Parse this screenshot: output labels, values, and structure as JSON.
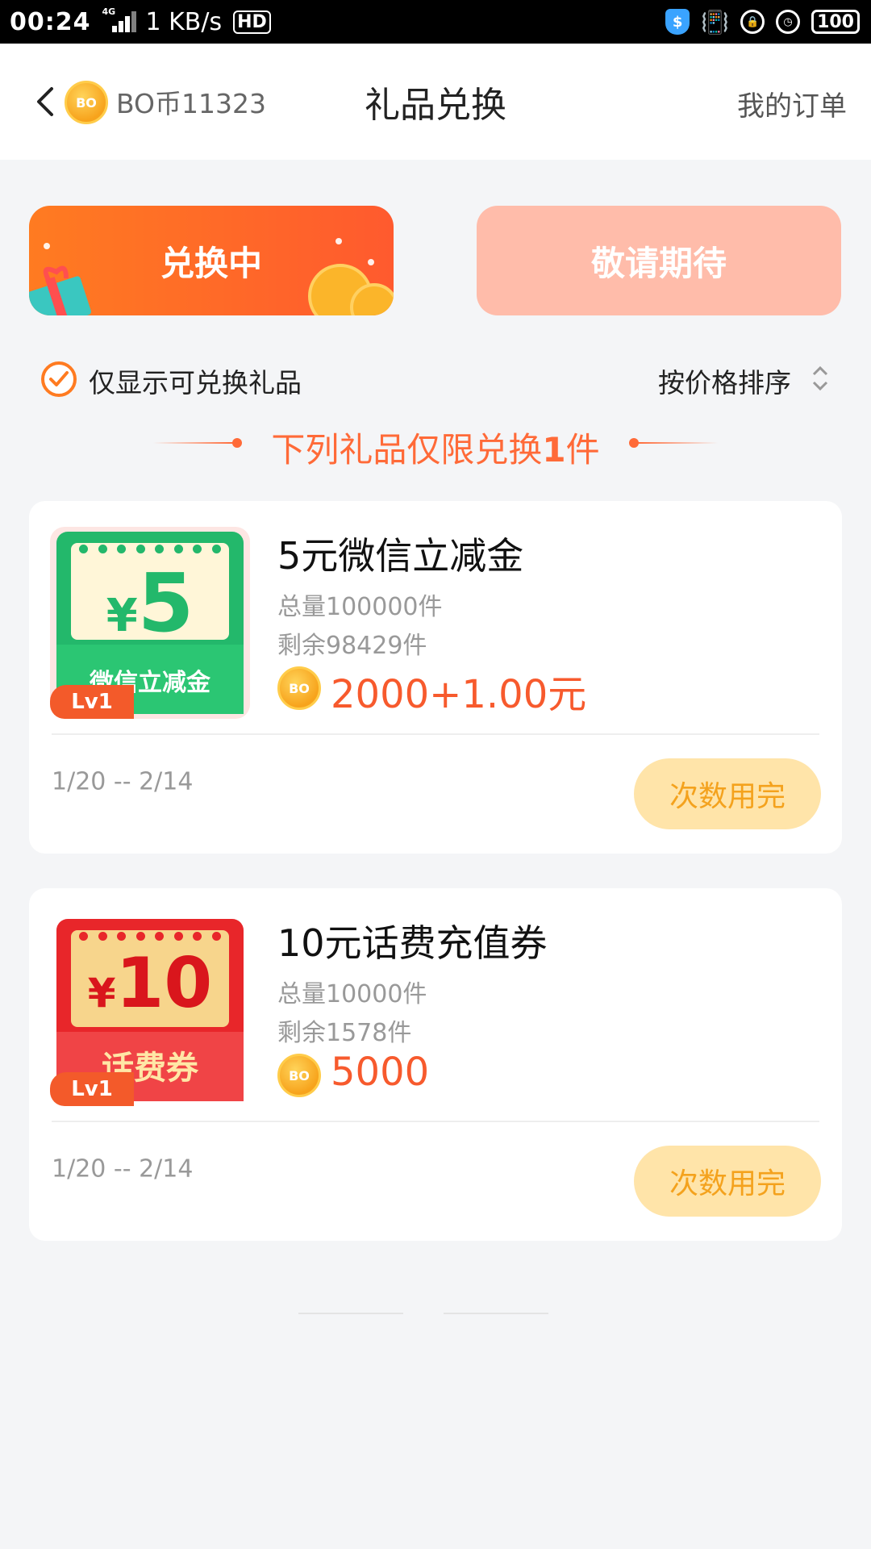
{
  "status_bar": {
    "time": "00:24",
    "network": "4G",
    "speed": "1 KB/s",
    "hd": "HD",
    "battery": "100"
  },
  "header": {
    "coin_icon_text": "BO",
    "balance": "BO币11323",
    "title": "礼品兑换",
    "orders_label": "我的订单"
  },
  "tabs": [
    {
      "label": "兑换中",
      "active": true
    },
    {
      "label": "敬请期待",
      "active": false
    }
  ],
  "filter": {
    "only_exchangeable_label": "仅显示可兑换礼品",
    "only_exchangeable_checked": true,
    "sort_label": "按价格排序"
  },
  "limit_notice": {
    "prefix": "下列礼品仅限兑换",
    "count": "1",
    "suffix": "件"
  },
  "gifts": [
    {
      "name": "5元微信立减金",
      "total": "总量100000件",
      "remaining": "剩余98429件",
      "price": "2000+1.00元",
      "coin_text": "BO",
      "level": "Lv1",
      "thumb_symbol": "¥",
      "thumb_amount": "5",
      "thumb_ribbon": "微信立减金",
      "thumb_color": "#23b86b",
      "date_range": "1/20 -- 2/14",
      "action_label": "次数用完"
    },
    {
      "name": "10元话费充值券",
      "total": "总量10000件",
      "remaining": "剩余1578件",
      "price": "5000",
      "coin_text": "BO",
      "level": "Lv1",
      "thumb_symbol": "¥",
      "thumb_amount": "10",
      "thumb_ribbon": "话费券",
      "thumb_color": "#e8262a",
      "date_range": "1/20 -- 2/14",
      "action_label": "次数用完"
    }
  ],
  "colors": {
    "accent": "#ff6a38",
    "price": "#f75a2d",
    "disabled_button_bg": "#ffe4a9",
    "disabled_button_text": "#f4a21d"
  }
}
